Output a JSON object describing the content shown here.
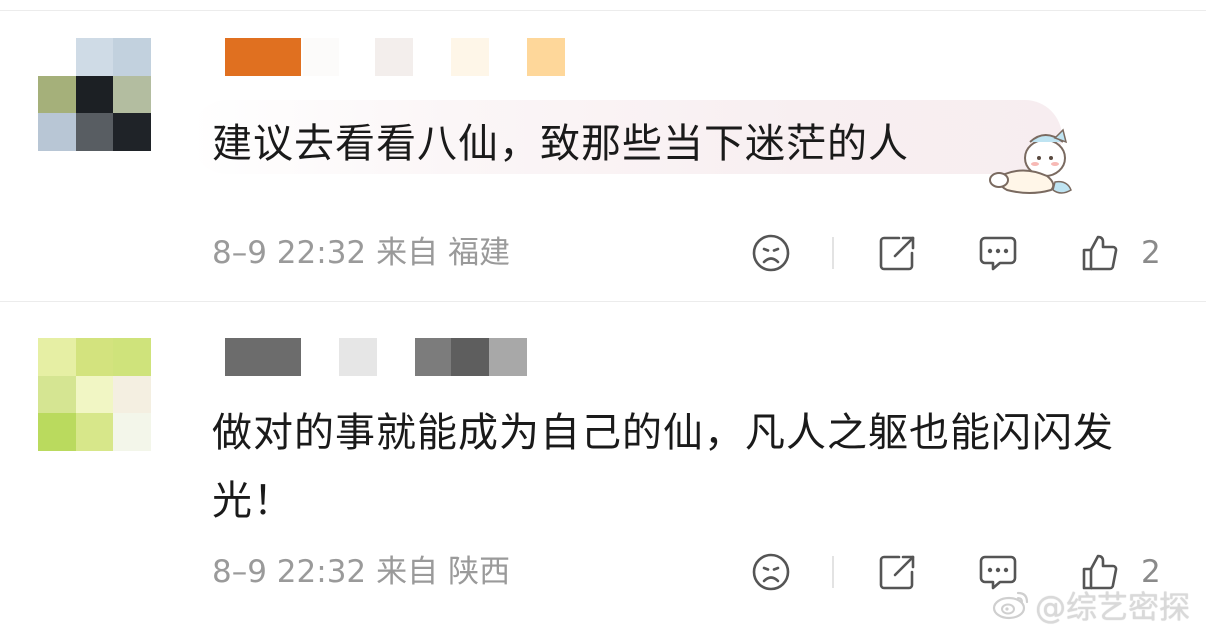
{
  "comments": [
    {
      "text": "建议去看看八仙，致那些当下迷茫的人",
      "time": "8–9 22:32",
      "location_prefix": "来自",
      "location": "福建",
      "like_count": "2",
      "sticker": "sleeping-cat-sticker",
      "avatar_colors": [
        "#ffffff",
        "#cfdbe6",
        "#c2d1de",
        "#a5b07a",
        "#1c2024",
        "#b3bda0",
        "#b8c6d5",
        "#585d62",
        "#1f2328"
      ],
      "name_colors": [
        "#e07020",
        "#fcfbfa",
        "#f3eeec",
        "#fef6e8",
        "#fed79a"
      ]
    },
    {
      "text": "做对的事就能成为自己的仙，凡人之躯也能闪闪发光！",
      "time": "8–9 22:32",
      "location_prefix": "来自",
      "location": "陕西",
      "like_count": "2",
      "avatar_colors": [
        "#e6efa4",
        "#d3e37e",
        "#cfe37b",
        "#d5e592",
        "#f1f6c4",
        "#f4efe1",
        "#bada5e",
        "#d7e78a",
        "#f3f6ea"
      ],
      "name_colors": [
        "#6c6c6c",
        "#e6e6e6",
        "#7c7c7c",
        "#5e5e5e",
        "#a8a8a8"
      ]
    }
  ],
  "icons": {
    "dislike": "sad-face-icon",
    "share": "share-icon",
    "reply": "comment-bubble-icon",
    "like": "thumbs-up-icon"
  },
  "watermark": {
    "text": "@综艺密探",
    "logo": "weibo-logo-icon"
  }
}
